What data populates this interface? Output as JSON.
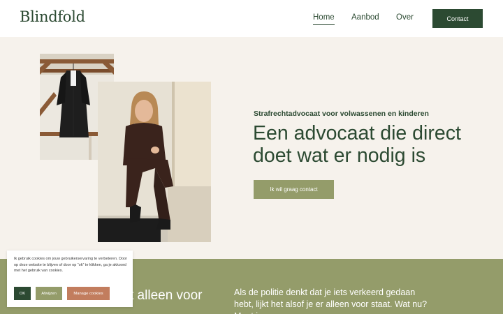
{
  "header": {
    "logo": "Blindfold",
    "nav": [
      {
        "label": "Home",
        "active": true
      },
      {
        "label": "Aanbod",
        "active": false
      },
      {
        "label": "Over",
        "active": false
      }
    ],
    "contact_button": "Contact"
  },
  "hero": {
    "subtitle": "Strafrechtadvocaat voor volwassenen en kinderen",
    "title": "Een advocaat die direct doet wat er nodig is",
    "cta_button": "Ik wil graag contact"
  },
  "green_section": {
    "heading_partial": "t alleen voor",
    "body": "Als de politie denkt dat je iets verkeerd gedaan hebt, lijkt het alsof je er alleen voor staat. Wat nu? Moet je"
  },
  "cookie_banner": {
    "text": "Ik gebruik cookies om jouw gebruikerservaring te verbeteren. Door op deze website te blijven of door op “ok” te klikken, ga je akkoord met het gebruik van cookies.",
    "ok_button": "OK",
    "reject_button": "Afwijzen",
    "manage_button": "Manage cookies"
  },
  "colors": {
    "brand_green": "#2c4a32",
    "olive": "#949c6a",
    "terracotta": "#c27d5e",
    "background": "#f6f2ec"
  }
}
